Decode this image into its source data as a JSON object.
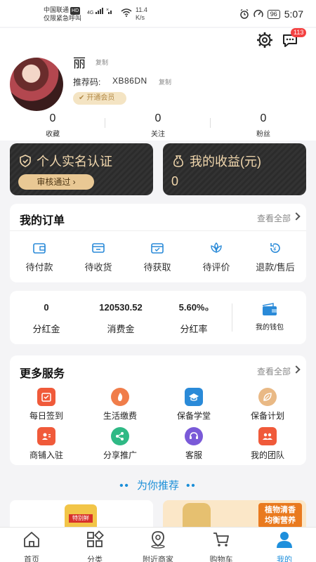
{
  "status_bar": {
    "carrier": "中国联通",
    "hd": "HD",
    "emergency": "仅限紧急呼叫",
    "net_4g": "4G",
    "speed_value": "11.4",
    "speed_unit": "K/s",
    "battery": "96",
    "time": "5:07"
  },
  "header": {
    "settings_icon": "gear-icon",
    "message_icon": "chat-icon",
    "message_badge": "113"
  },
  "profile": {
    "name": "丽",
    "copy_label": "复制",
    "referral_label": "推荐码:",
    "referral_code": "XB86DN",
    "vip_label": "开通会员"
  },
  "stats": [
    {
      "value": "0",
      "label": "收藏"
    },
    {
      "value": "0",
      "label": "关注"
    },
    {
      "value": "0",
      "label": "粉丝"
    }
  ],
  "verify_card": {
    "title": "个人实名认证",
    "button": "审核通过"
  },
  "earnings_card": {
    "title": "我的收益(元)",
    "value": "0"
  },
  "orders": {
    "title": "我的订单",
    "see_all": "查看全部",
    "items": [
      {
        "label": "待付款",
        "icon": "wallet-icon"
      },
      {
        "label": "待收货",
        "icon": "truck-icon"
      },
      {
        "label": "待获取",
        "icon": "box-icon"
      },
      {
        "label": "待评价",
        "icon": "flower-icon"
      },
      {
        "label": "退款/售后",
        "icon": "refund-icon"
      }
    ]
  },
  "wallet": {
    "dividend": {
      "value": "0",
      "label": "分红金"
    },
    "consumption": {
      "value": "120530.52",
      "label": "消费金"
    },
    "rate": {
      "value": "5.60%₀",
      "label": "分红率"
    },
    "my_wallet": "我的钱包"
  },
  "services": {
    "title": "更多服务",
    "see_all": "查看全部",
    "items": [
      {
        "label": "每日签到",
        "icon": "calendar-icon",
        "color": "#f05a3a"
      },
      {
        "label": "生活缴费",
        "icon": "flame-icon",
        "color": "#f07d4a"
      },
      {
        "label": "保备学堂",
        "icon": "graduation-icon",
        "color": "#2a8ad8"
      },
      {
        "label": "保备计划",
        "icon": "leaf-icon",
        "color": "#e9b985"
      },
      {
        "label": "商铺入驻",
        "icon": "user-card-icon",
        "color": "#f05a3a"
      },
      {
        "label": "分享推广",
        "icon": "share-icon",
        "color": "#2fb985"
      },
      {
        "label": "客服",
        "icon": "headset-icon",
        "color": "#7a5ad8"
      },
      {
        "label": "我的团队",
        "icon": "team-icon",
        "color": "#f05a3a"
      }
    ]
  },
  "recommend": {
    "title": "为你推荐",
    "dots": "••"
  },
  "product_banner": {
    "line1": "植物清香",
    "line2": "均衡营养",
    "brand": "特别鲜"
  },
  "tabbar": [
    {
      "label": "首页",
      "icon": "home-icon"
    },
    {
      "label": "分类",
      "icon": "category-icon"
    },
    {
      "label": "附近商家",
      "icon": "location-icon"
    },
    {
      "label": "购物车",
      "icon": "cart-icon"
    },
    {
      "label": "我的",
      "icon": "user-icon"
    }
  ],
  "colors": {
    "accent": "#1e8fdc",
    "gold": "#e9c894",
    "dark_card": "#2b2b2b"
  }
}
